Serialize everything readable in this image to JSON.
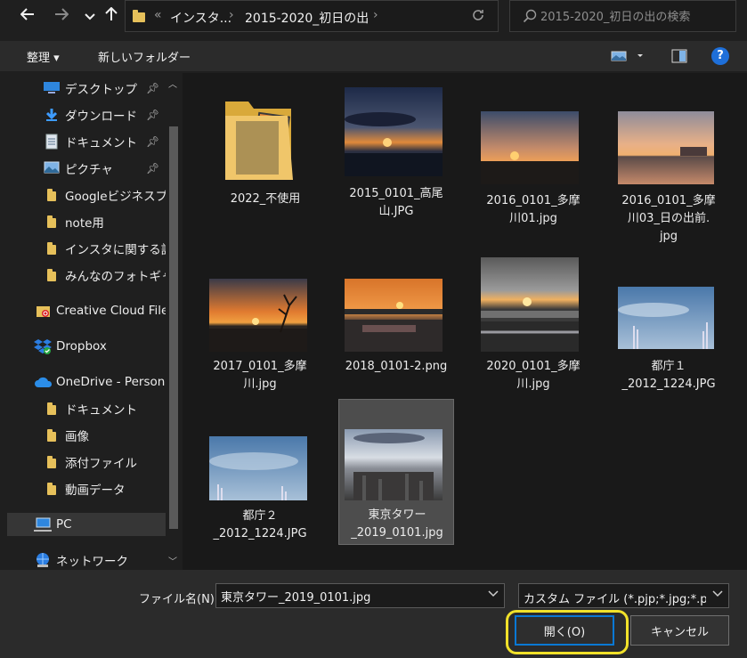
{
  "address_bar": {
    "back_icon": "arrow-left-icon",
    "forward_icon": "arrow-right-icon",
    "recent_icon": "chevron-down-icon",
    "up_icon": "arrow-up-icon",
    "overflow": "«",
    "segments": [
      "インスタ...",
      "2015-2020_初日の出"
    ],
    "refresh_icon": "refresh-icon",
    "search_placeholder": "2015-2020_初日の出の検索"
  },
  "toolbar": {
    "organize": "整理 ▾",
    "new_folder": "新しいフォルダー"
  },
  "sidebar": {
    "items": [
      {
        "label": "デスクトップ",
        "icon": "desktop-icon",
        "pinned": true
      },
      {
        "label": "ダウンロード",
        "icon": "download-icon",
        "pinned": true
      },
      {
        "label": "ドキュメント",
        "icon": "document-icon",
        "pinned": true
      },
      {
        "label": "ピクチャ",
        "icon": "pictures-icon",
        "pinned": true
      },
      {
        "label": "Googleビジネスプ",
        "icon": "folder-icon"
      },
      {
        "label": "note用",
        "icon": "folder-icon"
      },
      {
        "label": "インスタに関する記",
        "icon": "folder-icon"
      },
      {
        "label": "みんなのフォトギャラ",
        "icon": "folder-icon"
      },
      {
        "label": "Creative Cloud File",
        "icon": "creative-cloud-icon"
      },
      {
        "label": "Dropbox",
        "icon": "dropbox-icon"
      },
      {
        "label": "OneDrive - Person",
        "icon": "onedrive-icon"
      },
      {
        "label": "ドキュメント",
        "icon": "folder-icon"
      },
      {
        "label": "画像",
        "icon": "folder-icon"
      },
      {
        "label": "添付ファイル",
        "icon": "folder-icon"
      },
      {
        "label": "動画データ",
        "icon": "folder-icon"
      },
      {
        "label": "PC",
        "icon": "pc-icon"
      },
      {
        "label": "ネットワーク",
        "icon": "network-icon"
      }
    ]
  },
  "files": [
    {
      "name": "2022_不使用",
      "kind": "folder"
    },
    {
      "name": "2015_0101_高尾\n山.JPG",
      "kind": "image"
    },
    {
      "name": "2016_0101_多摩\n川01.jpg",
      "kind": "image"
    },
    {
      "name": "2016_0101_多摩\n川03_日の出前.\njpg",
      "kind": "image"
    },
    {
      "name": "2017_0101_多摩\n川.jpg",
      "kind": "image"
    },
    {
      "name": "2018_0101-2.png",
      "kind": "image"
    },
    {
      "name": "2020_0101_多摩\n川.jpg",
      "kind": "image"
    },
    {
      "name": "都庁１\n_2012_1224.JPG",
      "kind": "image"
    },
    {
      "name": "都庁２\n_2012_1224.JPG",
      "kind": "image"
    },
    {
      "name": "東京タワー\n_2019_0101.jpg",
      "kind": "image",
      "selected": true
    }
  ],
  "bottom": {
    "filename_label": "ファイル名(N):",
    "filename_value": "東京タワー_2019_0101.jpg",
    "filter_value": "カスタム ファイル (*.pjp;*.jpg;*.pjpe",
    "open_label": "開く(O)",
    "cancel_label": "キャンセル"
  },
  "colors": {
    "accent": "#0a78d4",
    "highlight": "#f1e12a",
    "folder": "#e6c05a"
  }
}
